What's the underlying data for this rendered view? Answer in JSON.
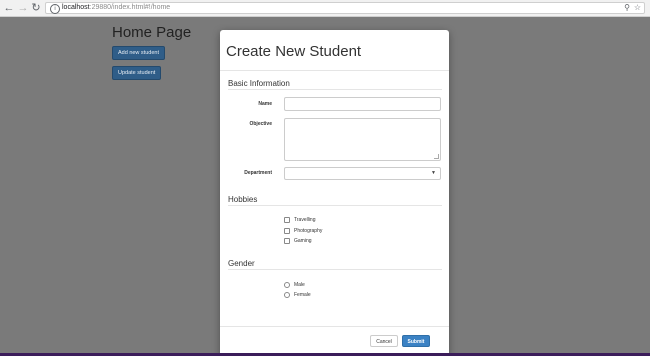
{
  "browser": {
    "url_host": "localhost",
    "url_rest": ":29880/index.html#!/home",
    "back_icon": "back-arrow-icon",
    "forward_icon": "forward-arrow-icon",
    "reload_icon": "reload-icon",
    "info_icon": "info-icon",
    "zoom_icon": "zoom-icon",
    "star_icon": "star-icon"
  },
  "page": {
    "title": "Home Page",
    "add_button": "Add new student",
    "update_button": "Update student"
  },
  "modal": {
    "title": "Create New Student",
    "basic_section": "Basic Information",
    "name_label": "Name",
    "name_value": "",
    "objective_label": "Objective",
    "objective_value": "",
    "department_label": "Department",
    "department_value": "",
    "hobbies_section": "Hobbies",
    "hobbies": [
      "Travelling",
      "Photography",
      "Gaming"
    ],
    "gender_section": "Gender",
    "genders": [
      "Male",
      "Female"
    ],
    "cancel_label": "Cancel",
    "submit_label": "Submit",
    "accent_color": "#3b82c4"
  }
}
